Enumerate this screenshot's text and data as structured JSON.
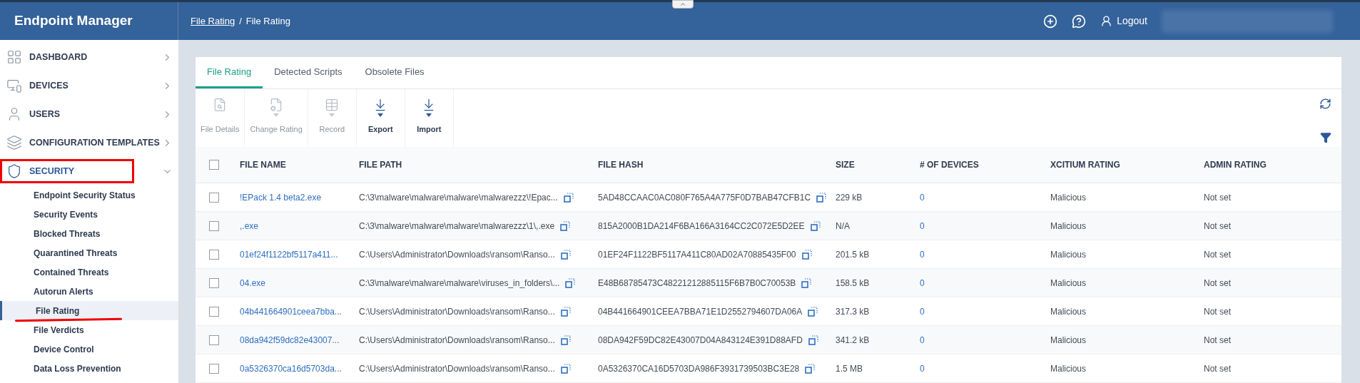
{
  "app": {
    "title": "Endpoint Manager"
  },
  "breadcrumb": [
    {
      "label": "File Rating",
      "kind": "link"
    },
    {
      "label": "/",
      "kind": "separator"
    },
    {
      "label": "File Rating",
      "kind": "current"
    }
  ],
  "header": {
    "logout": "Logout"
  },
  "sidebar": {
    "items": [
      {
        "label": "DASHBOARD",
        "expanded": false,
        "selected": false
      },
      {
        "label": "DEVICES",
        "expanded": false,
        "selected": false
      },
      {
        "label": "USERS",
        "expanded": false,
        "selected": false
      },
      {
        "label": "CONFIGURATION TEMPLATES",
        "expanded": false,
        "selected": false
      },
      {
        "label": "SECURITY",
        "expanded": true,
        "selected": true,
        "annotated": true,
        "children": [
          {
            "label": "Endpoint Security Status",
            "selected": false
          },
          {
            "label": "Security Events",
            "selected": false
          },
          {
            "label": "Blocked Threats",
            "selected": false
          },
          {
            "label": "Quarantined Threats",
            "selected": false
          },
          {
            "label": "Contained Threats",
            "selected": false
          },
          {
            "label": "Autorun Alerts",
            "selected": false
          },
          {
            "label": "File Rating",
            "selected": true,
            "annotated": true
          },
          {
            "label": "File Verdicts",
            "selected": false
          },
          {
            "label": "Device Control",
            "selected": false
          },
          {
            "label": "Data Loss Prevention",
            "selected": false
          }
        ]
      }
    ]
  },
  "tabs": [
    {
      "label": "File Rating",
      "selected": true
    },
    {
      "label": "Detected Scripts",
      "selected": false
    },
    {
      "label": "Obsolete Files",
      "selected": false
    }
  ],
  "toolbar": [
    {
      "label": "File Details",
      "disabled": true,
      "dropdown": false
    },
    {
      "label": "Change Rating",
      "disabled": true,
      "dropdown": true
    },
    {
      "label": "Record",
      "disabled": true,
      "dropdown": true
    },
    {
      "label": "Export",
      "disabled": false,
      "dropdown": true
    },
    {
      "label": "Import",
      "disabled": false,
      "dropdown": true
    }
  ],
  "table": {
    "all_checked": false,
    "columns": [
      "FILE NAME",
      "FILE PATH",
      "FILE HASH",
      "SIZE",
      "# OF DEVICES",
      "XCITIUM RATING",
      "ADMIN RATING"
    ],
    "rows": [
      {
        "checked": false,
        "name": "!EPack 1.4 beta2.exe",
        "path": "C:\\3\\malware\\malware\\malware\\malwarezzz\\!Epac...",
        "hash": "5AD48CCAAC0AC080F765A4A775F0D7BAB47CFB1C",
        "size": "229 kB",
        "devices": "0",
        "xcitium": "Malicious",
        "admin": "Not set"
      },
      {
        "checked": false,
        "name": ",.exe",
        "path": "C:\\3\\malware\\malware\\malware\\malwarezzz\\1\\,.exe",
        "hash": "815A2000B1DA214F6BA166A3164CC2C072E5D2EE",
        "size": "N/A",
        "devices": "0",
        "xcitium": "Malicious",
        "admin": "Not set"
      },
      {
        "checked": false,
        "name": "01ef24f1122bf5117a411...",
        "path": "C:\\Users\\Administrator\\Downloads\\ransom\\Ranso...",
        "hash": "01EF24F1122BF5117A411C80AD02A70885435F00",
        "size": "201.5 kB",
        "devices": "0",
        "xcitium": "Malicious",
        "admin": "Not set"
      },
      {
        "checked": false,
        "name": "04.exe",
        "path": "C:\\3\\malware\\malware\\malware\\viruses_in_folders\\...",
        "hash": "E48B68785473C48221212885115F6B7B0C70053B",
        "size": "158.5 kB",
        "devices": "0",
        "xcitium": "Malicious",
        "admin": "Not set"
      },
      {
        "checked": false,
        "name": "04b441664901ceea7bba...",
        "path": "C:\\Users\\Administrator\\Downloads\\ransom\\Ranso...",
        "hash": "04B441664901CEEA7BBA71E1D2552794607DA06A",
        "size": "317.3 kB",
        "devices": "0",
        "xcitium": "Malicious",
        "admin": "Not set"
      },
      {
        "checked": false,
        "name": "08da942f59dc82e43007...",
        "path": "C:\\Users\\Administrator\\Downloads\\ransom\\Ranso...",
        "hash": "08DA942F59DC82E43007D04A843124E391D88AFD",
        "size": "341.2 kB",
        "devices": "0",
        "xcitium": "Malicious",
        "admin": "Not set"
      },
      {
        "checked": false,
        "name": "0a5326370ca16d5703da...",
        "path": "C:\\Users\\Administrator\\Downloads\\ransom\\Ranso...",
        "hash": "0A5326370CA16D5703DA986F3931739503BC3E28",
        "size": "1.5 MB",
        "devices": "0",
        "xcitium": "Malicious",
        "admin": "Not set"
      }
    ]
  }
}
